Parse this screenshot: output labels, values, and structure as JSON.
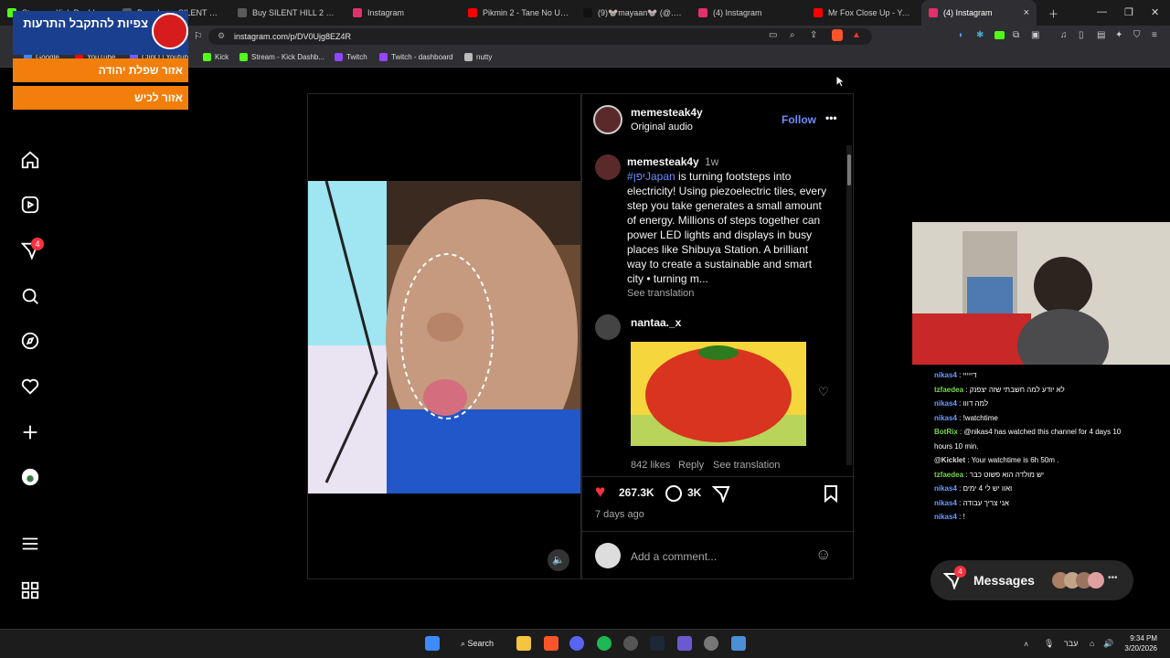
{
  "browser": {
    "tabs": [
      {
        "title": "Stream - Kick Dashboard",
        "color": "#53fc18"
      },
      {
        "title": "Buy cheap SILENT HILL 2 S",
        "color": "#5a5a5a"
      },
      {
        "title": "Buy SILENT HILL 2 PC CD K",
        "color": "#5a5a5a"
      },
      {
        "title": "Instagram",
        "color": "#e1306c"
      },
      {
        "title": "Pikmin 2 - Tane No Uta Ex",
        "color": "#ff0000"
      },
      {
        "title": "(9)🐭mayaan🐭 (@.therie",
        "color": "#111111"
      },
      {
        "title": "(4) Instagram",
        "color": "#e1306c"
      },
      {
        "title": "Mr Fox Close Up - YouTub",
        "color": "#ff0000"
      },
      {
        "title": "(4) Instagram",
        "color": "#e1306c",
        "active": true
      }
    ],
    "url": "instagram.com/p/DV0Ujg8EZ4R",
    "bookmarks": [
      {
        "label": "Google",
        "color": "#4285f4"
      },
      {
        "label": "YouTube",
        "color": "#ff0000"
      },
      {
        "label": "ClipQ | Youtub",
        "color": "#7b5cff"
      },
      {
        "label": "Kick",
        "color": "#53fc18"
      },
      {
        "label": "Stream - Kick Dashb...",
        "color": "#53fc18"
      },
      {
        "label": "Twitch",
        "color": "#9146ff"
      },
      {
        "label": "Twitch - dashboard",
        "color": "#9146ff"
      },
      {
        "label": "nutty",
        "color": "#bbbbbb"
      }
    ]
  },
  "overlay": {
    "title": "צפיות להתקבל התרעות",
    "line1": "אזור שפלת יהודה",
    "line2": "אזור לכיש"
  },
  "nav": {
    "notification_count": "4",
    "icons": [
      "home-icon",
      "reels-icon",
      "messages-icon",
      "search-icon",
      "explore-icon",
      "heart-icon",
      "create-icon",
      "profile-icon",
      "menu-icon",
      "apps-icon"
    ]
  },
  "post": {
    "author": "memesteak4y",
    "audio": "Original audio",
    "follow_label": "Follow",
    "caption_author": "memesteak4y",
    "caption_time": "1w",
    "hashtag": "#יפןJapan",
    "caption_lines": [
      " is turning footsteps into",
      "electricity! Using piezoelectric tiles, every",
      "step you take generates a small amount",
      "of energy. Millions of steps together can",
      "power LED lights and displays in busy",
      "places like Shibuya Station. A brilliant",
      "way to create a sustainable and smart",
      "city • turning m..."
    ],
    "see_translation": "See translation",
    "comment_user": "nantaa._x",
    "comment_likes": "842 likes",
    "reply_label": "Reply",
    "comment_translation": "See translation",
    "likes": "267.3K",
    "comments": "3K",
    "posted": "7 days ago",
    "comment_placeholder": "Add a comment..."
  },
  "chat": {
    "lines": [
      {
        "user": "nikas4",
        "color": "#6b9bff",
        "msg": "דייייי"
      },
      {
        "user": "tzfaedea",
        "color": "#7ad84a",
        "msg": "לא יודע למה חשבתי שזה יצפנק"
      },
      {
        "user": "nikas4",
        "color": "#6b9bff",
        "msg": "למה דווו"
      },
      {
        "user": "nikas4",
        "color": "#6b9bff",
        "msg": "!watchtime"
      },
      {
        "user": "BotRix",
        "color": "#7ad84a",
        "msg": "@nikas4 has watched this channel for 4 days 10"
      },
      {
        "user": "",
        "color": "#ffffff",
        "msg": "hours 10 min."
      },
      {
        "user": "@Kicklet",
        "color": "#dddddd",
        "msg": "Your watchtime is 6h 50m ."
      },
      {
        "user": "tzfaedea",
        "color": "#7ad84a",
        "msg": "יש מולדה הוא פשוט כבר"
      },
      {
        "user": "nikas4",
        "color": "#6b9bff",
        "msg": "ואוו יש לי 4 ימים"
      },
      {
        "user": "nikas4",
        "color": "#6b9bff",
        "msg": "אני צריך עבודה"
      },
      {
        "user": "nikas4",
        "color": "#6b9bff",
        "msg": "!"
      }
    ]
  },
  "messages": {
    "label": "Messages",
    "badge": "4"
  },
  "taskbar": {
    "search_label": "Search",
    "lang": "עבר",
    "time": "9:34 PM",
    "date": "3/20/2026"
  }
}
